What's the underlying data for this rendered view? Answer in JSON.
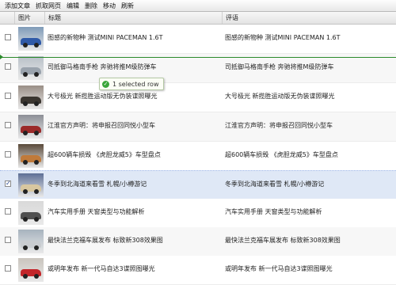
{
  "toolbar": {
    "buttons": [
      "添加文章",
      "抓取网页",
      "编辑",
      "删除",
      "移动",
      "刷新"
    ]
  },
  "columns": {
    "image": "图片",
    "title": "标题",
    "summary": "评语"
  },
  "rows": [
    {
      "title": "图感的新物种 测试MINI PACEMAN 1.6T",
      "summary": "图感的新物种 测试MINI PACEMAN 1.6T",
      "checked": false,
      "thumb": "blue-car-photo"
    },
    {
      "title": "司抵御马格南手枪 奔驰将推M级防弹车",
      "summary": "司抵御马格南手枪 奔驰将推M级防弹车",
      "checked": false,
      "thumb": "silver-suv-photo"
    },
    {
      "title": "大号极光 新揽胜运动版无伪装谍照曝光",
      "summary": "大号极光 新揽胜运动版无伪装谍照曝光",
      "checked": false,
      "thumb": "dark-suv-photo"
    },
    {
      "title": "江淮官方声明：将申报召回同悦小型车",
      "summary": "江淮官方声明：将申报召回同悦小型车",
      "checked": false,
      "thumb": "red-sedan-photo"
    },
    {
      "title": "超600辆车损毁 《虎胆龙威5》车型盘点",
      "summary": "超600辆车损毁 《虎胆龙威5》车型盘点",
      "checked": false,
      "thumb": "movie-scene-photo"
    },
    {
      "title": "冬季到北海道来看雪 札幌/小樽游记",
      "summary": "冬季到北海道来看雪 札幌/小樽游记",
      "checked": true,
      "thumb": "snow-travel-photo"
    },
    {
      "title": "汽车实用手册 天窗类型与功能解析",
      "summary": "汽车实用手册 天窗类型与功能解析",
      "checked": false,
      "thumb": "sunroof-photo"
    },
    {
      "title": "最快法兰克福车展发布 标致新308效果图",
      "summary": "最快法兰克福车展发布 标致新308效果图",
      "checked": false,
      "thumb": "hatchback-photo"
    },
    {
      "title": "或明年发布 新一代马自达3谍照图曝光",
      "summary": "或明年发布 新一代马自达3谍照图曝光",
      "checked": false,
      "thumb": "red-hatchback-photo"
    }
  ],
  "tooltip": {
    "text": "1 selected row",
    "icon": "check-circle-icon"
  },
  "colors": {
    "selected_row": "#dfe8f6",
    "drag_indicator": "#2a8a2a"
  }
}
